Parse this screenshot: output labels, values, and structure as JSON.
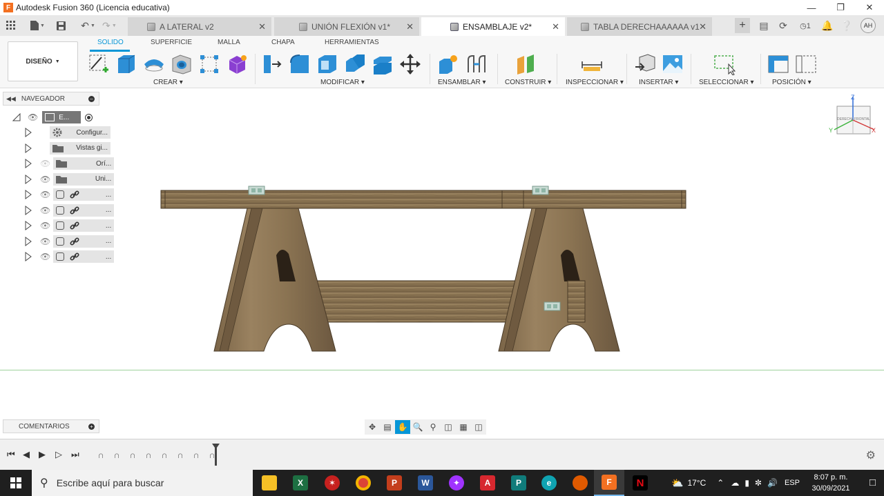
{
  "window": {
    "title": "Autodesk Fusion 360 (Licencia educativa)"
  },
  "tabs": [
    {
      "label": "A LATERAL v2",
      "active": false
    },
    {
      "label": "UNIÓN FLEXIÓN v1*",
      "active": false
    },
    {
      "label": "ENSAMBLAJE v2*",
      "active": true
    },
    {
      "label": "TABLA DERECHAAAAAA v1",
      "active": false
    }
  ],
  "header": {
    "jobs_count": "1",
    "user_initials": "AH"
  },
  "toolbar": {
    "workspace": "DISEÑO",
    "workspace_tabs": [
      "SOLIDO",
      "SUPERFICIE",
      "MALLA",
      "CHAPA",
      "HERRAMIENTAS"
    ],
    "groups": [
      "CREAR",
      "MODIFICAR",
      "ENSAMBLAR",
      "CONSTRUIR",
      "INSPECCIONAR",
      "INSERTAR",
      "SELECCIONAR",
      "POSICIÓN"
    ]
  },
  "browser": {
    "title": "NAVEGADOR",
    "root_label": "E...",
    "items": [
      {
        "label": "Configur...",
        "icon": "gear-icon"
      },
      {
        "label": "Vistas gi...",
        "icon": "folder-icon"
      },
      {
        "label": "Orí...",
        "icon": "folder-icon"
      },
      {
        "label": "Uni...",
        "icon": "folder-icon"
      },
      {
        "label": "...",
        "icon": "link-icon"
      },
      {
        "label": "...",
        "icon": "link-icon"
      },
      {
        "label": "...",
        "icon": "link-icon"
      },
      {
        "label": "...",
        "icon": "link-icon"
      },
      {
        "label": "...",
        "icon": "link-icon"
      }
    ]
  },
  "viewcube": {
    "front": "FRONTAL",
    "side": "DERECHA",
    "z": "Z",
    "x": "X",
    "y": "Y"
  },
  "comments": {
    "title": "COMENTARIOS"
  },
  "taskbar": {
    "search_placeholder": "Escribe aquí para buscar",
    "temperature": "17°C",
    "language": "ESP",
    "time": "8:07 p. m.",
    "date": "30/09/2021"
  },
  "colors": {
    "accent": "#0696d7",
    "wood": "#8a7352",
    "ground": "#9fd19c"
  }
}
